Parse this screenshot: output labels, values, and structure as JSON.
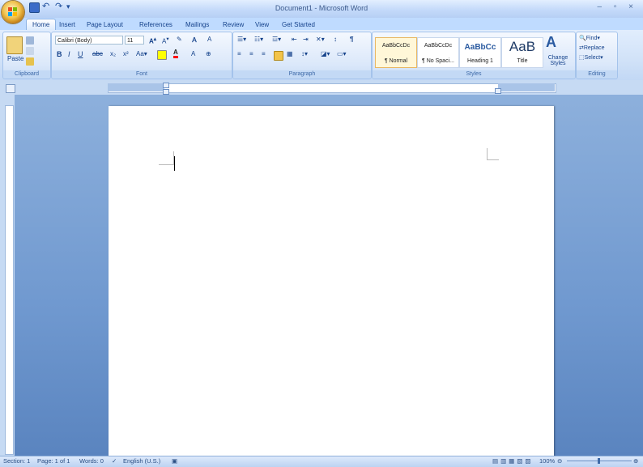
{
  "window": {
    "title": "Document1 - Microsoft Word",
    "controls": "–   ▫   ×"
  },
  "quick_access": {
    "icons": [
      "save-icon",
      "undo-icon",
      "redo-icon",
      "customize-icon"
    ]
  },
  "tabs": [
    "Home",
    "Insert",
    "Page Layout",
    "References",
    "Mailings",
    "Review",
    "View",
    "Get Started"
  ],
  "active_tab": "Home",
  "ribbon": {
    "clipboard": {
      "label": "Clipboard",
      "paste": "Paste"
    },
    "font": {
      "label": "Font",
      "font_name": "Calibri (Body)",
      "font_size": "11"
    },
    "paragraph": {
      "label": "Paragraph"
    },
    "styles": {
      "label": "Styles",
      "items": [
        {
          "sample": "AaBbCcDc",
          "name": "¶ Normal"
        },
        {
          "sample": "AaBbCcDc",
          "name": "¶ No Spaci..."
        },
        {
          "sample": "AaBbCc",
          "name": "Heading 1"
        },
        {
          "sample": "AaB",
          "name": "Title"
        }
      ],
      "change_styles": "Change Styles"
    },
    "editing": {
      "label": "Editing",
      "find": "Find",
      "replace": "Replace",
      "select": "Select"
    }
  },
  "status": {
    "section": "Section: 1",
    "page": "Page: 1 of 1",
    "words": "Words: 0",
    "language": "English (U.S.)",
    "zoom": "100%"
  },
  "colors": {
    "accent": "#15428b",
    "ribbon_bg": "#d1e2f8",
    "workspace": "#6f98cf",
    "highlight": "#ffff00",
    "font_color": "#ff0000"
  }
}
